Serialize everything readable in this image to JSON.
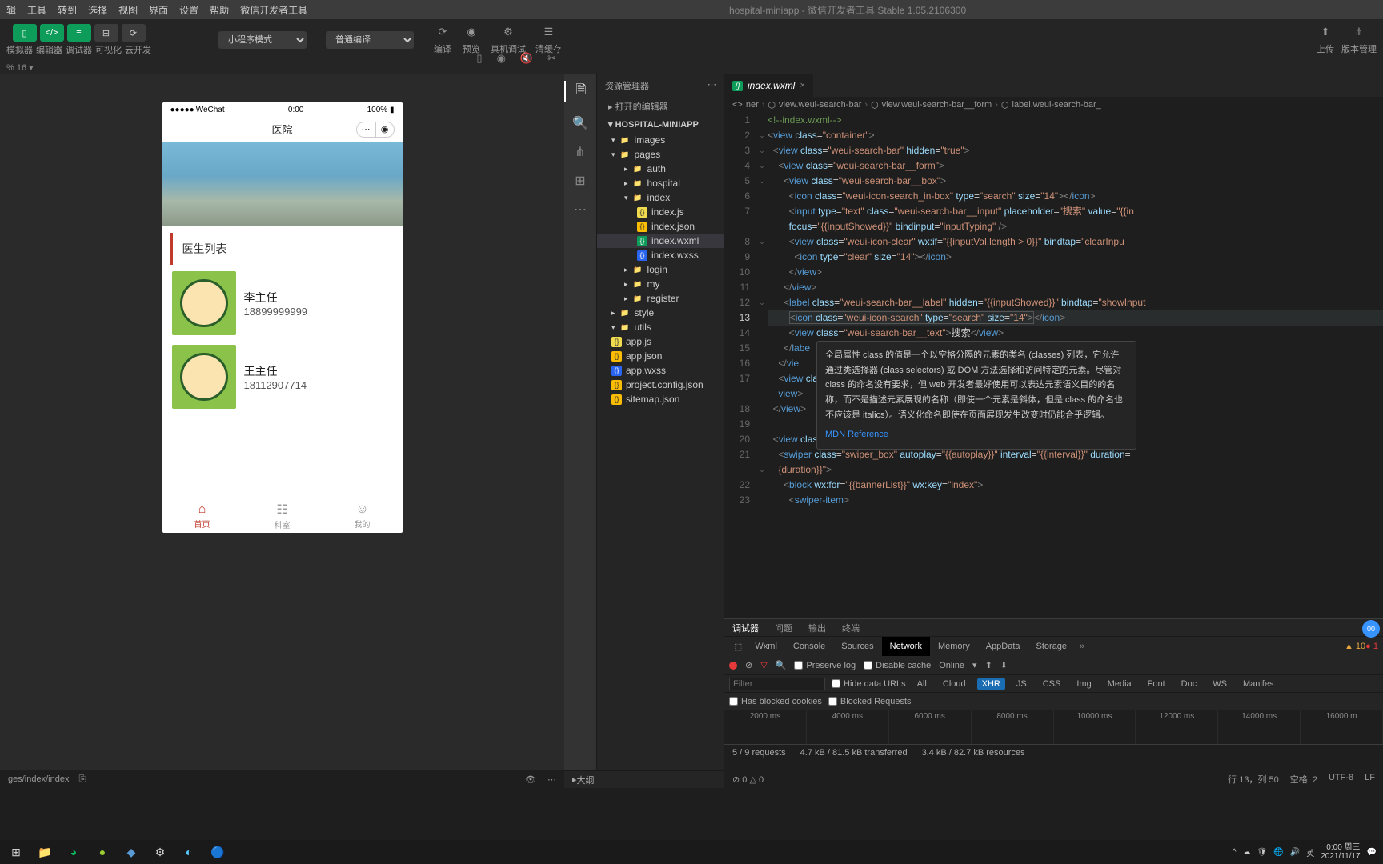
{
  "menu": {
    "items": [
      "辑",
      "工具",
      "转到",
      "选择",
      "视图",
      "界面",
      "设置",
      "帮助",
      "微信开发者工具"
    ],
    "title": "hospital-miniapp - 微信开发者工具 Stable 1.05.2106300"
  },
  "toolbar": {
    "modes": [
      "模拟器",
      "编辑器",
      "调试器",
      "可视化",
      "云开发"
    ],
    "selects": {
      "mode": "小程序模式",
      "compile": "普通编译"
    },
    "actions": [
      "编译",
      "预览",
      "真机调试",
      "清缓存"
    ],
    "right": [
      "上传",
      "版本管理"
    ]
  },
  "zoom": "% 16 ▾",
  "phone": {
    "carrier": "WeChat",
    "time": "0:00",
    "battery": "100%",
    "header": "医院",
    "sectionTitle": "医生列表",
    "doctors": [
      {
        "name": "李主任",
        "tel": "18899999999"
      },
      {
        "name": "王主任",
        "tel": "18112907714"
      }
    ],
    "tabs": [
      {
        "icon": "⌂",
        "label": "首页"
      },
      {
        "icon": "☷",
        "label": "科室"
      },
      {
        "icon": "☺",
        "label": "我的"
      }
    ]
  },
  "explorer": {
    "header": "资源管理器",
    "openEditors": "打开的编辑器",
    "root": "HOSPITAL-MINIAPP",
    "tree": [
      {
        "d": 1,
        "type": "folder",
        "icon": "fi-blue",
        "open": true,
        "label": "images"
      },
      {
        "d": 1,
        "type": "folder",
        "icon": "fi-blue",
        "open": true,
        "label": "pages"
      },
      {
        "d": 2,
        "type": "folder",
        "icon": "fi-folder",
        "label": "auth"
      },
      {
        "d": 2,
        "type": "folder",
        "icon": "fi-folder",
        "label": "hospital"
      },
      {
        "d": 2,
        "type": "folder",
        "icon": "fi-folder",
        "open": true,
        "label": "index"
      },
      {
        "d": 3,
        "type": "file",
        "icon": "fi-js",
        "label": "index.js"
      },
      {
        "d": 3,
        "type": "file",
        "icon": "fi-json",
        "label": "index.json"
      },
      {
        "d": 3,
        "type": "file",
        "icon": "fi-wxml",
        "label": "index.wxml",
        "active": true
      },
      {
        "d": 3,
        "type": "file",
        "icon": "fi-wxss",
        "label": "index.wxss"
      },
      {
        "d": 2,
        "type": "folder",
        "icon": "fi-folder",
        "label": "login"
      },
      {
        "d": 2,
        "type": "folder",
        "icon": "fi-folder",
        "label": "my"
      },
      {
        "d": 2,
        "type": "folder",
        "icon": "fi-folder",
        "label": "register"
      },
      {
        "d": 1,
        "type": "folder",
        "icon": "fi-blue",
        "label": "style"
      },
      {
        "d": 1,
        "type": "folder",
        "icon": "fi-blue",
        "open": true,
        "label": "utils"
      },
      {
        "d": 1,
        "type": "file",
        "icon": "fi-js",
        "label": "app.js"
      },
      {
        "d": 1,
        "type": "file",
        "icon": "fi-json",
        "label": "app.json"
      },
      {
        "d": 1,
        "type": "file",
        "icon": "fi-wxss",
        "label": "app.wxss"
      },
      {
        "d": 1,
        "type": "file",
        "icon": "fi-json",
        "label": "project.config.json"
      },
      {
        "d": 1,
        "type": "file",
        "icon": "fi-json",
        "label": "sitemap.json"
      }
    ],
    "outline": "大纲"
  },
  "editor": {
    "tab": "index.wxml",
    "breadcrumb": [
      "ner",
      "view.weui-search-bar",
      "view.weui-search-bar__form",
      "label.weui-search-bar_"
    ],
    "tooltip": {
      "body": "全局属性 class 的值是一个以空格分隔的元素的类名 (classes) 列表，它允许通过类选择器 (class selectors) 或 DOM 方法选择和访问特定的元素。尽管对 class 的命名没有要求，但 web 开发者最好使用可以表达元素语义目的的名称，而不是描述元素展现的名称（即使一个元素是斜体，但是 class 的命名也不应该是 italics）。语义化命名即使在页面展现发生改变时仍能合乎逻辑。",
      "link": "MDN Reference"
    }
  },
  "devtools": {
    "outerTabs": [
      "调试器",
      "问题",
      "输出",
      "终端"
    ],
    "tabs": [
      "Wxml",
      "Console",
      "Sources",
      "Network",
      "Memory",
      "AppData",
      "Storage"
    ],
    "preserveLog": "Preserve log",
    "disableCache": "Disable cache",
    "online": "Online",
    "filter": "Filter",
    "hideDataUrls": "Hide data URLs",
    "filterTypes": [
      "All",
      "Cloud",
      "XHR",
      "JS",
      "CSS",
      "Img",
      "Media",
      "Font",
      "Doc",
      "WS",
      "Manifes"
    ],
    "hasBlocked": "Has blocked cookies",
    "blockedReq": "Blocked Requests",
    "timeline": [
      "2000 ms",
      "4000 ms",
      "6000 ms",
      "8000 ms",
      "10000 ms",
      "12000 ms",
      "14000 ms",
      "16000 m"
    ],
    "status": {
      "requests": "5 / 9 requests",
      "transferred": "4.7 kB / 81.5 kB transferred",
      "resources": "3.4 kB / 82.7 kB resources"
    },
    "warn": "▲ 10",
    "err": "● 1"
  },
  "statusbar": {
    "path": "ges/index/index",
    "errors": "⊘ 0 △ 0",
    "pos": "行 13，列 50",
    "spaces": "空格: 2",
    "encoding": "UTF-8",
    "eol": "LF"
  },
  "tray": {
    "time": "0:00 周三",
    "date": "2021/11/17"
  }
}
